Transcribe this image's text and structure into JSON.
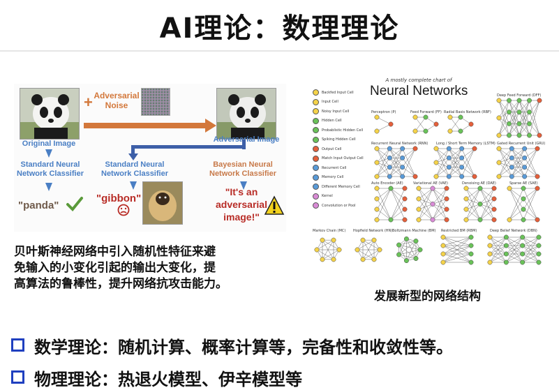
{
  "slide": {
    "title": "AI理论：数理理论",
    "description": "贝叶斯神经网络中引入随机性特征来避免输入的小变化引起的输出大变化，提高算法的鲁棒性，提升网络抗攻击能力。",
    "description_lines": [
      "贝叶斯神经网络中引入随机性特征来避",
      "免输入的小变化引起的输出大变化，提",
      "高算法的鲁棒性，提升网络抗攻击能力。"
    ],
    "right_caption": "发展新型的网络结构",
    "bullets": [
      "数学理论：随机计算、概率计算等，完备性和收敛性等。",
      "物理理论：热退火模型、伊辛模型等"
    ]
  },
  "adversarial": {
    "adversarial_noise": "Adversarial Noise",
    "adv_word": "Adversarial",
    "noise_word": "Noise",
    "original_image": "Original Image",
    "adversarial_image": "Adversarial Image",
    "standard_nn_1": "Standard Neural Network Classifier",
    "standard_nn_2": "Standard Neural Network Classifier",
    "bayesian_nn": "Bayesian Neural Network Classifier",
    "out_panda": "\"panda\"",
    "out_gibbon": "\"gibbon\"",
    "out_adv_l1": "\"It's an",
    "out_adv_l2": "adversarial",
    "out_adv_l3": "image!\"",
    "colors": {
      "blue": "#4a7fc4",
      "orange": "#d3783b",
      "red": "#b82c26"
    }
  },
  "nn_chart": {
    "subtitle": "A mostly complete chart of",
    "title": "Neural Networks",
    "legend": [
      "Backfed Input Cell",
      "Input Cell",
      "Noisy Input Cell",
      "Hidden Cell",
      "Probablistic Hidden Cell",
      "Spiking Hidden Cell",
      "Output Cell",
      "Match Input Output Cell",
      "Recurrent Cell",
      "Memory Cell",
      "Different Memory Cell",
      "Kernel",
      "Convolution or Pool"
    ],
    "legend_colors": [
      "#f5d34a",
      "#f5d34a",
      "#f5d34a",
      "#6ac259",
      "#6ac259",
      "#6ac259",
      "#e5603b",
      "#e5603b",
      "#5a9bd8",
      "#5a9bd8",
      "#5a9bd8",
      "#d98bd6",
      "#d98bd6"
    ],
    "row1": [
      "Perceptron (P)",
      "Feed Forward (FF)",
      "Radial Basis Network (RBF)",
      "Deep Feed Forward (DFF)"
    ],
    "row2": [
      "Recurrent Neural Network (RNN)",
      "Long / Short Term Memory (LSTM)",
      "Gated Recurrent Unit (GRU)"
    ],
    "row3": [
      "Auto Encoder (AE)",
      "Variational AE (VAE)",
      "Denoising AE (DAE)",
      "Sparse AE (SAE)"
    ],
    "row4": [
      "Markov Chain (MC)",
      "Hopfield Network (HN)",
      "Boltzmann Machine (BM)",
      "Restricted BM (RBM)",
      "Deep Belief Network (DBN)"
    ]
  }
}
